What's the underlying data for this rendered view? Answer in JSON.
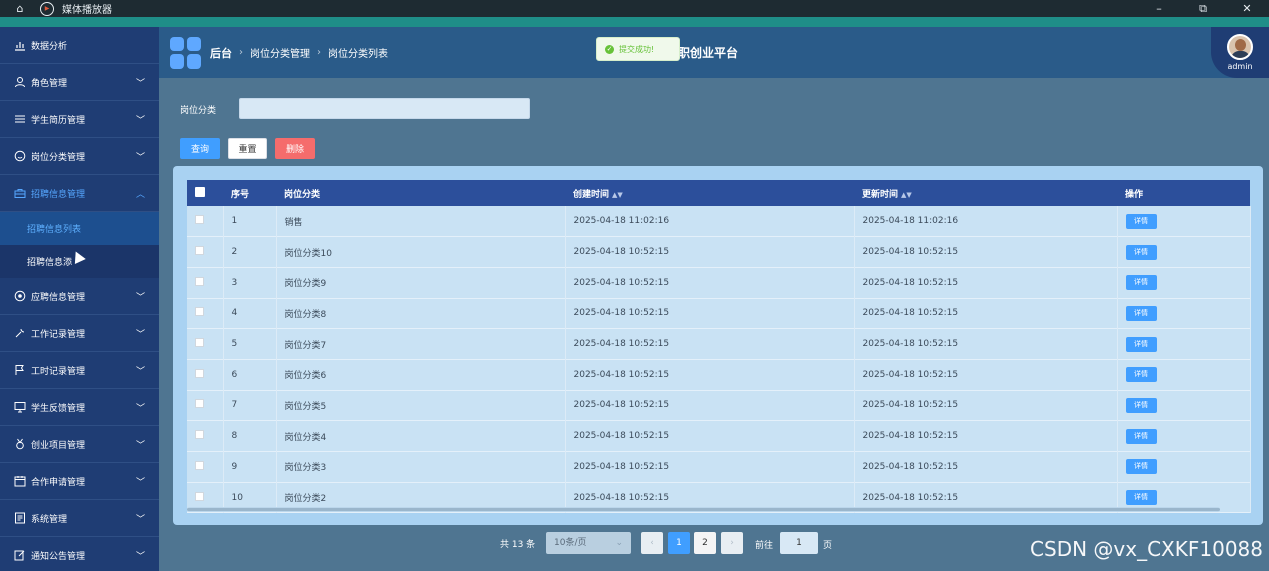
{
  "titlebar": {
    "title": "媒体播放器",
    "minimize": "–",
    "restore": "⧉",
    "close": "✕"
  },
  "sidebar": {
    "items": [
      {
        "label": "数据分析",
        "icon": "chart-icon",
        "has_chevron": false
      },
      {
        "label": "角色管理",
        "icon": "user-icon",
        "has_chevron": true
      },
      {
        "label": "学生简历管理",
        "icon": "list-icon",
        "has_chevron": true
      },
      {
        "label": "岗位分类管理",
        "icon": "smile-icon",
        "has_chevron": true
      },
      {
        "label": "招聘信息管理",
        "icon": "briefcase-icon",
        "has_chevron": true,
        "open": true
      }
    ],
    "subitems": [
      {
        "label": "招聘信息列表",
        "active": true
      },
      {
        "label": "招聘信息添",
        "active": false
      }
    ],
    "items2": [
      {
        "label": "应聘信息管理",
        "icon": "badge-icon"
      },
      {
        "label": "工作记录管理",
        "icon": "tools-icon"
      },
      {
        "label": "工时记录管理",
        "icon": "flag-icon"
      },
      {
        "label": "学生反馈管理",
        "icon": "monitor-icon"
      },
      {
        "label": "创业项目管理",
        "icon": "medal-icon"
      },
      {
        "label": "合作申请管理",
        "icon": "calendar-icon"
      },
      {
        "label": "系统管理",
        "icon": "document-icon"
      },
      {
        "label": "通知公告管理",
        "icon": "edit-icon"
      }
    ]
  },
  "header": {
    "breadcrumb": [
      "后台",
      "岗位分类管理",
      "岗位分类列表"
    ],
    "site_title": "职创业平台",
    "toast": "提交成功!",
    "user": "admin"
  },
  "search": {
    "label": "岗位分类",
    "value": "",
    "query": "查询",
    "reset": "重置",
    "delete": "删除"
  },
  "table": {
    "headers": [
      "序号",
      "岗位分类",
      "创建时间",
      "更新时间",
      "操作"
    ],
    "detail_label": "详情",
    "rows": [
      [
        "1",
        "销售",
        "2025-04-18 11:02:16",
        "2025-04-18 11:02:16"
      ],
      [
        "2",
        "岗位分类10",
        "2025-04-18 10:52:15",
        "2025-04-18 10:52:15"
      ],
      [
        "3",
        "岗位分类9",
        "2025-04-18 10:52:15",
        "2025-04-18 10:52:15"
      ],
      [
        "4",
        "岗位分类8",
        "2025-04-18 10:52:15",
        "2025-04-18 10:52:15"
      ],
      [
        "5",
        "岗位分类7",
        "2025-04-18 10:52:15",
        "2025-04-18 10:52:15"
      ],
      [
        "6",
        "岗位分类6",
        "2025-04-18 10:52:15",
        "2025-04-18 10:52:15"
      ],
      [
        "7",
        "岗位分类5",
        "2025-04-18 10:52:15",
        "2025-04-18 10:52:15"
      ],
      [
        "8",
        "岗位分类4",
        "2025-04-18 10:52:15",
        "2025-04-18 10:52:15"
      ],
      [
        "9",
        "岗位分类3",
        "2025-04-18 10:52:15",
        "2025-04-18 10:52:15"
      ],
      [
        "10",
        "岗位分类2",
        "2025-04-18 10:52:15",
        "2025-04-18 10:52:15"
      ]
    ]
  },
  "pagination": {
    "total": "共 13 条",
    "page_size": "10条/页",
    "pages": [
      "1",
      "2"
    ],
    "current": "1",
    "goto_label": "前往",
    "goto_value": "1",
    "page_unit": "页"
  },
  "watermark": "CSDN @vx_CXKF10088",
  "colors": {
    "sidebar": "#1f3d74",
    "header": "#2a5b89",
    "accent": "#409eff",
    "danger": "#f56c6c",
    "table_header": "#2c4f9b",
    "teal_bar": "#1f8e88"
  }
}
